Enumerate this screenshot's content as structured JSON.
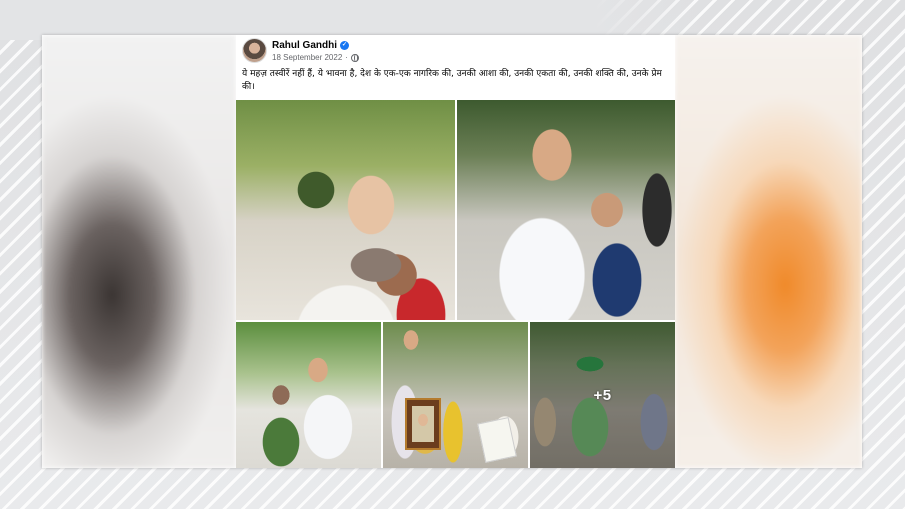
{
  "post": {
    "author": "Rahul Gandhi",
    "date": "18 September 2022",
    "separator": "·",
    "caption": "ये महज़ तस्वीरें नहीं हैं, ये भावना है, देश के एक-एक नागरिक की, उनकी आशा की, उनकी एकता की, उनकी शक्ति की, उनके प्रेम की।",
    "more_photos": "+5",
    "icons": {
      "verified": "verified-badge-icon",
      "audience": "globe-icon"
    },
    "colors": {
      "verified": "#1877f2",
      "meta_text": "#65676b",
      "text": "#050505"
    }
  }
}
